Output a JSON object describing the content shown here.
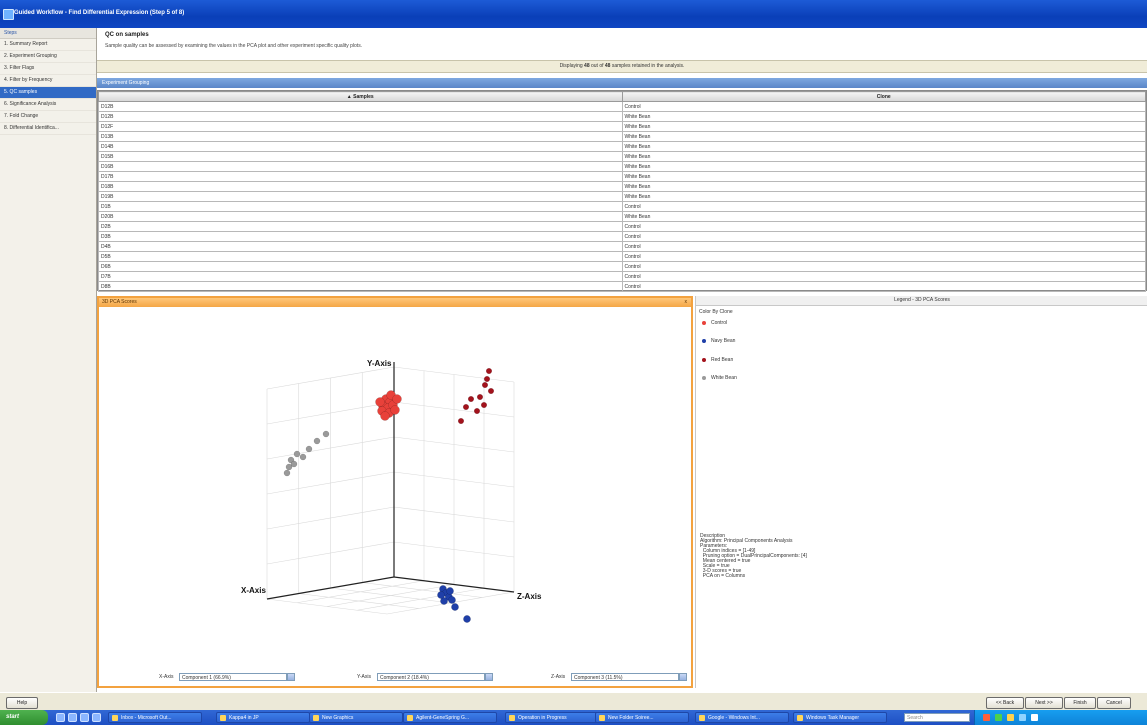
{
  "window": {
    "title": "Guided Workflow - Find Differential Expression (Step 5 of 8)"
  },
  "sidebar": {
    "steps_label": "Steps",
    "items": [
      {
        "label": "1. Summary Report"
      },
      {
        "label": "2. Experiment Grouping"
      },
      {
        "label": "3. Filter Flags"
      },
      {
        "label": "4. Filter by Frequency"
      },
      {
        "label": "5. QC samples"
      },
      {
        "label": "6. Significance Analysis"
      },
      {
        "label": "7. Fold Change"
      },
      {
        "label": "8. Differential Identifica..."
      }
    ],
    "active_index": 4
  },
  "qc": {
    "title": "QC on samples",
    "description": "Sample quality can be assessed by examining the values in the PCA plot and other experiment specific quality plots."
  },
  "display_bar": {
    "prefix": "Displaying",
    "shown": "48",
    "middle": "out of",
    "total": "48",
    "suffix": "samples retained in the analysis."
  },
  "experiment_grouping": {
    "title": "Experiment Grouping",
    "columns": [
      "▲ Samples",
      "Clone"
    ],
    "rows": [
      [
        "D12B",
        "Control"
      ],
      [
        "D12B",
        "White Bean"
      ],
      [
        "D12F",
        "White Bean"
      ],
      [
        "D13B",
        "White Bean"
      ],
      [
        "D14B",
        "White Bean"
      ],
      [
        "D15B",
        "White Bean"
      ],
      [
        "D16B",
        "White Bean"
      ],
      [
        "D17B",
        "White Bean"
      ],
      [
        "D18B",
        "White Bean"
      ],
      [
        "D19B",
        "White Bean"
      ],
      [
        "D1B",
        "Control"
      ],
      [
        "D20B",
        "White Bean"
      ],
      [
        "D2B",
        "Control"
      ],
      [
        "D3B",
        "Control"
      ],
      [
        "D4B",
        "Control"
      ],
      [
        "D5B",
        "Control"
      ],
      [
        "D6B",
        "Control"
      ],
      [
        "D7B",
        "Control"
      ],
      [
        "D8B",
        "Control"
      ]
    ]
  },
  "pca_panel": {
    "title": "3D PCA Scores",
    "close": "x",
    "y_axis_label": "Y-Axis",
    "x_axis_label": "X-Axis",
    "z_axis_label": "Z-Axis",
    "controls": {
      "x": {
        "label": "X-Axis",
        "value": "Component 1 (66.9%)"
      },
      "y": {
        "label": "Y-Axis",
        "value": "Component 2 (18.4%)"
      },
      "z": {
        "label": "Z-Axis",
        "value": "Component 3 (11.5%)"
      }
    }
  },
  "legend": {
    "title": "Legend - 3D PCA Scores",
    "color_by": "Color By Clone",
    "items": [
      {
        "label": "Control",
        "color": "#e8413a"
      },
      {
        "label": "Navy Bean",
        "color": "#1f3fa8"
      },
      {
        "label": "Red Bean",
        "color": "#a3121c"
      },
      {
        "label": "White Bean",
        "color": "#9a9a9a"
      }
    ],
    "description": "Description\nAlgorithm: Principal Components Analysis\nParameters:\n  Column indices = [1-49]\n  Pruning option = DualPrincipalComponents: [4]\n  Mean centered = true\n  Scale = true\n  3-D scores = true\n  PCA on = Columns"
  },
  "buttons": {
    "help": "Help",
    "back": "<< Back",
    "next": "Next >>",
    "finish": "Finish",
    "cancel": "Cancel"
  },
  "taskbar": {
    "start": "start",
    "tasks": [
      "Inbox - Microsoft Out...",
      "Kappa4 in JP",
      "New Graphics",
      "Agilent-GeneSpring G...",
      "Operation in Progress",
      "New Folder Soiree...",
      "Google - Windows Int...",
      "Windows Task Manager"
    ],
    "search_placeholder": "Search"
  },
  "chart_data": {
    "type": "scatter",
    "dimensions": 3,
    "axes": [
      "X-Axis",
      "Y-Axis",
      "Z-Axis"
    ],
    "series": [
      {
        "name": "Control",
        "color": "#e8413a"
      },
      {
        "name": "Navy Bean",
        "color": "#1f3fa8"
      },
      {
        "name": "Red Bean",
        "color": "#a3121c"
      },
      {
        "name": "White Bean",
        "color": "#9a9a9a"
      }
    ],
    "grid": true
  }
}
